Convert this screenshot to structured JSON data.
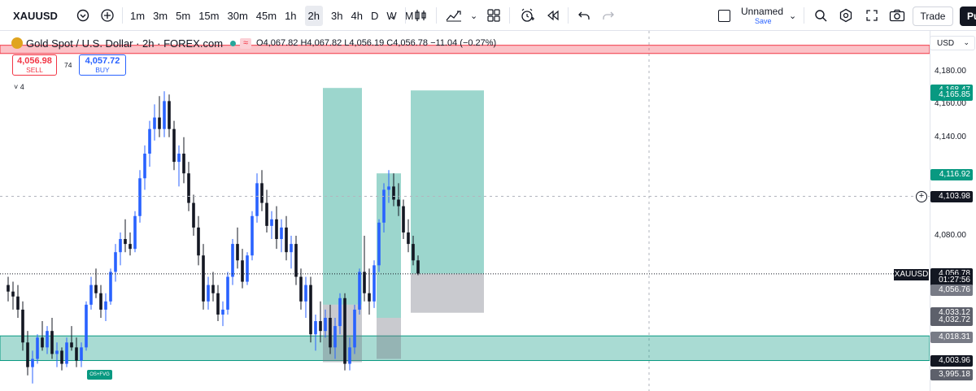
{
  "toolbar": {
    "symbol": "XAUUSD",
    "timeframes": [
      "1m",
      "3m",
      "5m",
      "15m",
      "30m",
      "45m",
      "1h",
      "2h",
      "3h",
      "4h",
      "D",
      "W",
      "M"
    ],
    "active_timeframe": "2h",
    "layout_name": "Unnamed",
    "save_label": "Save",
    "trade_label": "Trade",
    "publish_label": "Pu",
    "icons": [
      "symbol-search-icon",
      "add-compare-icon",
      "chevron-down-icon",
      "candle-style-icon",
      "indicators-icon",
      "templates-icon",
      "alert-icon",
      "replay-icon",
      "undo-icon",
      "redo-icon",
      "search-icon",
      "settings-icon",
      "fullscreen-icon",
      "camera-icon"
    ]
  },
  "legend": {
    "title": "Gold Spot / U.S. Dollar · 2h · FOREX.com",
    "approx_symbol": "≈",
    "ohlc": "O4,067.82 H4,067.82 L4,056.19 C4,056.78 −11.04 (−0.27%)"
  },
  "order_panel": {
    "sell_price": "4,056.98",
    "sell_label": "SELL",
    "spread": "74",
    "buy_price": "4,057.72",
    "buy_label": "BUY"
  },
  "indicators_count": "˅ 4",
  "osfvg_label": "OS+FVG",
  "price_axis": {
    "currency": "USD",
    "ticks": [
      {
        "label": "4,180.00",
        "price": 4180
      },
      {
        "label": "4,160.00",
        "price": 4160
      },
      {
        "label": "4,140.00",
        "price": 4140
      },
      {
        "label": "4,080.00",
        "price": 4080
      }
    ],
    "labels": [
      {
        "label": "4,168.47",
        "price": 4168.47,
        "color": "#089981"
      },
      {
        "label": "4,165.85",
        "price": 4165.85,
        "color": "#089981"
      },
      {
        "label": "4,116.92",
        "price": 4116.92,
        "color": "#089981"
      },
      {
        "label": "4,103.98",
        "price": 4103.98,
        "color": "#131722"
      },
      {
        "label": "4,056.78",
        "price": 4056.78,
        "color": "#131722"
      },
      {
        "label": "01:27:56",
        "price": 4052.8,
        "color": "#131722"
      },
      {
        "label": "4,056.76",
        "price": 4046.9,
        "color": "#787b86"
      },
      {
        "label": "4,033.12",
        "price": 4033.12,
        "color": "#5d606b"
      },
      {
        "label": "4,032.72",
        "price": 4028.3,
        "color": "#5d606b"
      },
      {
        "label": "4,018.31",
        "price": 4018.31,
        "color": "#787b86"
      },
      {
        "label": "4,003.96",
        "price": 4003.96,
        "color": "#131722"
      },
      {
        "label": "3,995.18",
        "price": 3995.18,
        "color": "#5d606b"
      }
    ],
    "last_price_tag": "XAUUSD"
  },
  "chart_data": {
    "type": "candlestick",
    "symbol": "XAUUSD",
    "interval": "2h",
    "ylim": [
      3985,
      4200
    ],
    "candles": [
      [
        4050,
        4055,
        4040,
        4046
      ],
      [
        4046,
        4052,
        4035,
        4043
      ],
      [
        4043,
        4050,
        4030,
        4035
      ],
      [
        4035,
        4040,
        4010,
        4015
      ],
      [
        4015,
        4022,
        3995,
        4000
      ],
      [
        4000,
        4010,
        3990,
        4005
      ],
      [
        4005,
        4020,
        4002,
        4018
      ],
      [
        4018,
        4028,
        4010,
        4012
      ],
      [
        4012,
        4025,
        4008,
        4022
      ],
      [
        4022,
        4030,
        4005,
        4008
      ],
      [
        4008,
        4015,
        4000,
        4010
      ],
      [
        4010,
        4012,
        3998,
        4002
      ],
      [
        4002,
        4018,
        4000,
        4015
      ],
      [
        4015,
        4025,
        4010,
        4012
      ],
      [
        4012,
        4018,
        4000,
        4004
      ],
      [
        4004,
        4015,
        4000,
        4012
      ],
      [
        4012,
        4040,
        4010,
        4038
      ],
      [
        4038,
        4055,
        4035,
        4050
      ],
      [
        4050,
        4060,
        4042,
        4045
      ],
      [
        4045,
        4050,
        4030,
        4035
      ],
      [
        4035,
        4045,
        4028,
        4040
      ],
      [
        4040,
        4060,
        4038,
        4058
      ],
      [
        4058,
        4075,
        4052,
        4070
      ],
      [
        4070,
        4082,
        4062,
        4078
      ],
      [
        4078,
        4090,
        4070,
        4075
      ],
      [
        4075,
        4082,
        4068,
        4072
      ],
      [
        4072,
        4095,
        4070,
        4092
      ],
      [
        4092,
        4120,
        4088,
        4115
      ],
      [
        4115,
        4135,
        4108,
        4130
      ],
      [
        4130,
        4150,
        4122,
        4145
      ],
      [
        4145,
        4160,
        4138,
        4152
      ],
      [
        4152,
        4165,
        4140,
        4145
      ],
      [
        4145,
        4168,
        4140,
        4162
      ],
      [
        4162,
        4166,
        4140,
        4145
      ],
      [
        4145,
        4150,
        4120,
        4125
      ],
      [
        4125,
        4135,
        4110,
        4130
      ],
      [
        4130,
        4140,
        4112,
        4118
      ],
      [
        4118,
        4125,
        4095,
        4100
      ],
      [
        4100,
        4105,
        4080,
        4085
      ],
      [
        4085,
        4092,
        4062,
        4068
      ],
      [
        4068,
        4075,
        4035,
        4040
      ],
      [
        4040,
        4055,
        4035,
        4050
      ],
      [
        4050,
        4058,
        4040,
        4045
      ],
      [
        4045,
        4050,
        4028,
        4032
      ],
      [
        4032,
        4040,
        4025,
        4035
      ],
      [
        4035,
        4058,
        4032,
        4055
      ],
      [
        4055,
        4078,
        4050,
        4075
      ],
      [
        4075,
        4085,
        4060,
        4065
      ],
      [
        4065,
        4072,
        4048,
        4052
      ],
      [
        4052,
        4070,
        4050,
        4068
      ],
      [
        4068,
        4095,
        4065,
        4092
      ],
      [
        4092,
        4118,
        4088,
        4112
      ],
      [
        4112,
        4120,
        4095,
        4100
      ],
      [
        4100,
        4108,
        4082,
        4086
      ],
      [
        4086,
        4095,
        4078,
        4090
      ],
      [
        4090,
        4098,
        4072,
        4078
      ],
      [
        4078,
        4090,
        4070,
        4085
      ],
      [
        4085,
        4092,
        4065,
        4070
      ],
      [
        4070,
        4080,
        4060,
        4075
      ],
      [
        4075,
        4080,
        4050,
        4055
      ],
      [
        4055,
        4060,
        4035,
        4040
      ],
      [
        4040,
        4055,
        4030,
        4050
      ],
      [
        4050,
        4055,
        4015,
        4020
      ],
      [
        4020,
        4032,
        4010,
        4028
      ],
      [
        4028,
        4040,
        4015,
        4022
      ],
      [
        4022,
        4035,
        4018,
        4030
      ],
      [
        4030,
        4038,
        4008,
        4012
      ],
      [
        4012,
        4030,
        4005,
        4025
      ],
      [
        4025,
        4045,
        4020,
        4042
      ],
      [
        4042,
        4045,
        3998,
        4002
      ],
      [
        4002,
        4018,
        3998,
        4012
      ],
      [
        4012,
        4038,
        4008,
        4035
      ],
      [
        4035,
        4060,
        4032,
        4058
      ],
      [
        4058,
        4080,
        4040,
        4045
      ],
      [
        4045,
        4060,
        4032,
        4040
      ],
      [
        4040,
        4065,
        4036,
        4062
      ],
      [
        4062,
        4090,
        4058,
        4088
      ],
      [
        4088,
        4112,
        4082,
        4108
      ],
      [
        4108,
        4120,
        4100,
        4110
      ],
      [
        4110,
        4118,
        4098,
        4102
      ],
      [
        4102,
        4112,
        4092,
        4098
      ],
      [
        4098,
        4102,
        4078,
        4082
      ],
      [
        4082,
        4090,
        4070,
        4075
      ],
      [
        4075,
        4080,
        4062,
        4065
      ],
      [
        4065,
        4068,
        4056,
        4057
      ]
    ],
    "positions": [
      {
        "type": "long",
        "entry": 4038,
        "target": 4170,
        "stop": 4003
      },
      {
        "type": "long",
        "entry": 4030,
        "target": 4118,
        "stop": 4005
      },
      {
        "type": "long",
        "entry": 4057,
        "target": 4168.5,
        "stop": 4033.1
      }
    ],
    "zones": [
      {
        "label": "OS+FVG",
        "top": 4019,
        "bottom": 4004,
        "color": "#089981"
      },
      {
        "top": 4196,
        "bottom": 4191,
        "color": "#f23645"
      }
    ],
    "lines": [
      {
        "price": 4103.98,
        "style": "dashed"
      },
      {
        "price": 4056.78,
        "style": "dotted"
      }
    ],
    "grid": true
  }
}
